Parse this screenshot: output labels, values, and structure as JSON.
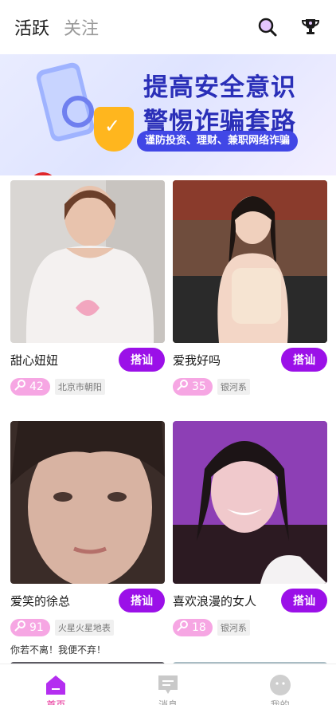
{
  "header": {
    "tabs": [
      {
        "label": "活跃",
        "active": true
      },
      {
        "label": "关注",
        "active": false
      }
    ],
    "icons": [
      "search-icon",
      "trophy-icon"
    ]
  },
  "banner": {
    "line1": "提高安全意识",
    "line2": "警惕诈骗套路",
    "subtitle": "谨防投资、理财、兼职网络诈骗"
  },
  "cards": [
    {
      "name": "甜心妞妞",
      "button": "搭讪",
      "score": "42",
      "location": "北京市朝阳",
      "signature": ""
    },
    {
      "name": "爱我好吗",
      "button": "搭讪",
      "score": "35",
      "location": "银河系",
      "signature": ""
    },
    {
      "name": "爱笑的徐总",
      "button": "搭讪",
      "score": "91",
      "location": "火星火星地表",
      "signature": "你若不离！我便不弃！"
    },
    {
      "name": "喜欢浪漫的女人",
      "button": "搭讪",
      "score": "18",
      "location": "银河系",
      "signature": ""
    }
  ],
  "nav": {
    "items": [
      {
        "label": "首页",
        "icon": "home-icon",
        "active": true
      },
      {
        "label": "消息",
        "icon": "message-icon",
        "active": false
      },
      {
        "label": "我的",
        "icon": "profile-icon",
        "active": false
      }
    ]
  },
  "colors": {
    "accent": "#9b10e8",
    "score_bg": "#f6a6e3",
    "nav_active": "#e62a96",
    "banner_text": "#2a2fb8"
  }
}
